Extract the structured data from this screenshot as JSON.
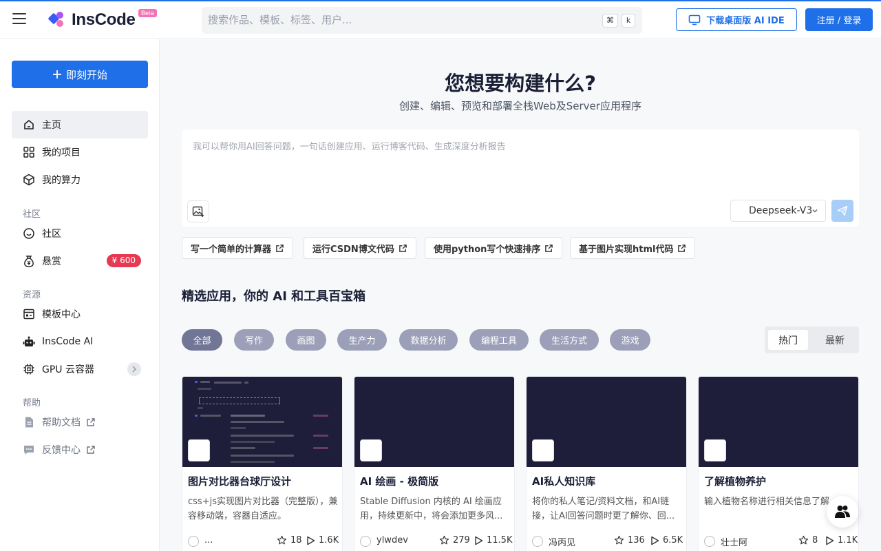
{
  "header": {
    "logo_text": "InsCode",
    "beta": "Beta",
    "search_placeholder": "搜索作品、模板、标签、用户...",
    "kbd_cmd": "⌘",
    "kbd_k": "k",
    "download_label": "下载桌面版 AI IDE",
    "login_label": "注册 / 登录"
  },
  "sidebar": {
    "start_label": "即刻开始",
    "items": {
      "home": "主页",
      "projects": "我的项目",
      "compute": "我的算力",
      "community": "社区",
      "bounty": "悬赏",
      "templates": "模板中心",
      "inscode_ai": "InsCode AI",
      "gpu": "GPU 云容器",
      "docs": "帮助文档",
      "feedback": "反馈中心"
    },
    "bounty_badge": "¥ 600",
    "sections": {
      "community": "社区",
      "resources": "资源",
      "help": "帮助"
    }
  },
  "hero": {
    "title": "您想要构建什么?",
    "subtitle": "创建、编辑、预览和部署全栈Web及Server应用程序",
    "prompt_placeholder": "我可以帮你用AI回答问题，一句话创建应用、运行博客代码、生成深度分析报告",
    "model": "Deepseek-V3"
  },
  "suggestions": [
    "写一个简单的计算器",
    "运行CSDN博文代码",
    "使用python写个快速排序",
    "基于图片实现html代码"
  ],
  "apps": {
    "title": "精选应用，你的 AI 和工具百宝箱",
    "filters": [
      "全部",
      "写作",
      "画图",
      "生产力",
      "数据分析",
      "编程工具",
      "生活方式",
      "游戏"
    ],
    "sort": {
      "hot": "热门",
      "new": "最新"
    },
    "cards": [
      {
        "title": "图片对比器台球厅设计",
        "desc": "css+js实现图片对比器（完整版），兼容移动端，容器自适应。",
        "author": "...",
        "stars": "18",
        "plays": "1.6K"
      },
      {
        "title": "AI 绘画 - 极简版",
        "desc": "Stable Diffusion 内核的 AI 绘画应用，持续更新中，将会添加更多风...",
        "author": "ylwdev",
        "stars": "279",
        "plays": "11.5K"
      },
      {
        "title": "AI私人知识库",
        "desc": "将你的私人笔记/资料文档，和AI链接，让AI回答问题时更了解你、回...",
        "author": "冯丙见",
        "stars": "136",
        "plays": "6.5K"
      },
      {
        "title": "了解植物养护",
        "desc": "输入植物名称进行相关信息了解",
        "author": "壮士阿",
        "stars": "8",
        "plays": "1.1K"
      }
    ]
  },
  "colors": {
    "accent": "#1f6fe8",
    "badge_red": "#e63a52",
    "chip": "#9b9fb8",
    "chip_active": "#717696",
    "thumb": "#1e1e3a"
  }
}
